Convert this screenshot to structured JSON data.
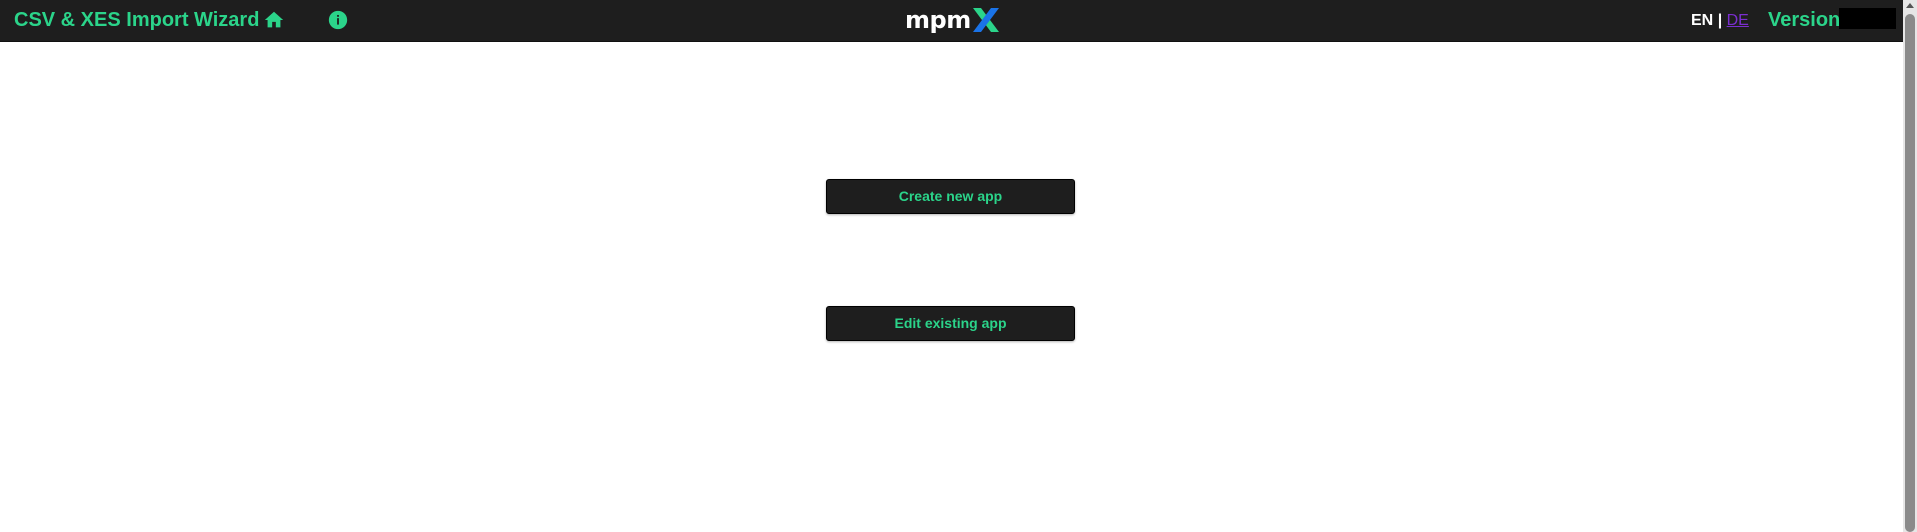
{
  "header": {
    "title": "CSV & XES Import Wizard",
    "home_icon": "home-icon",
    "info_icon": "info-icon",
    "logo_text": "mpm",
    "logo_letter": "X",
    "lang_en": "EN",
    "lang_sep": "|",
    "lang_de": "DE",
    "version_label": "Version"
  },
  "main": {
    "create_label": "Create new app",
    "edit_label": "Edit existing app"
  },
  "colors": {
    "accent": "#2bd48a",
    "bar": "#1e1e1e",
    "link_de": "#7b2ed0",
    "logo_x_green": "#2bd48a",
    "logo_x_blue": "#1a73e8"
  }
}
